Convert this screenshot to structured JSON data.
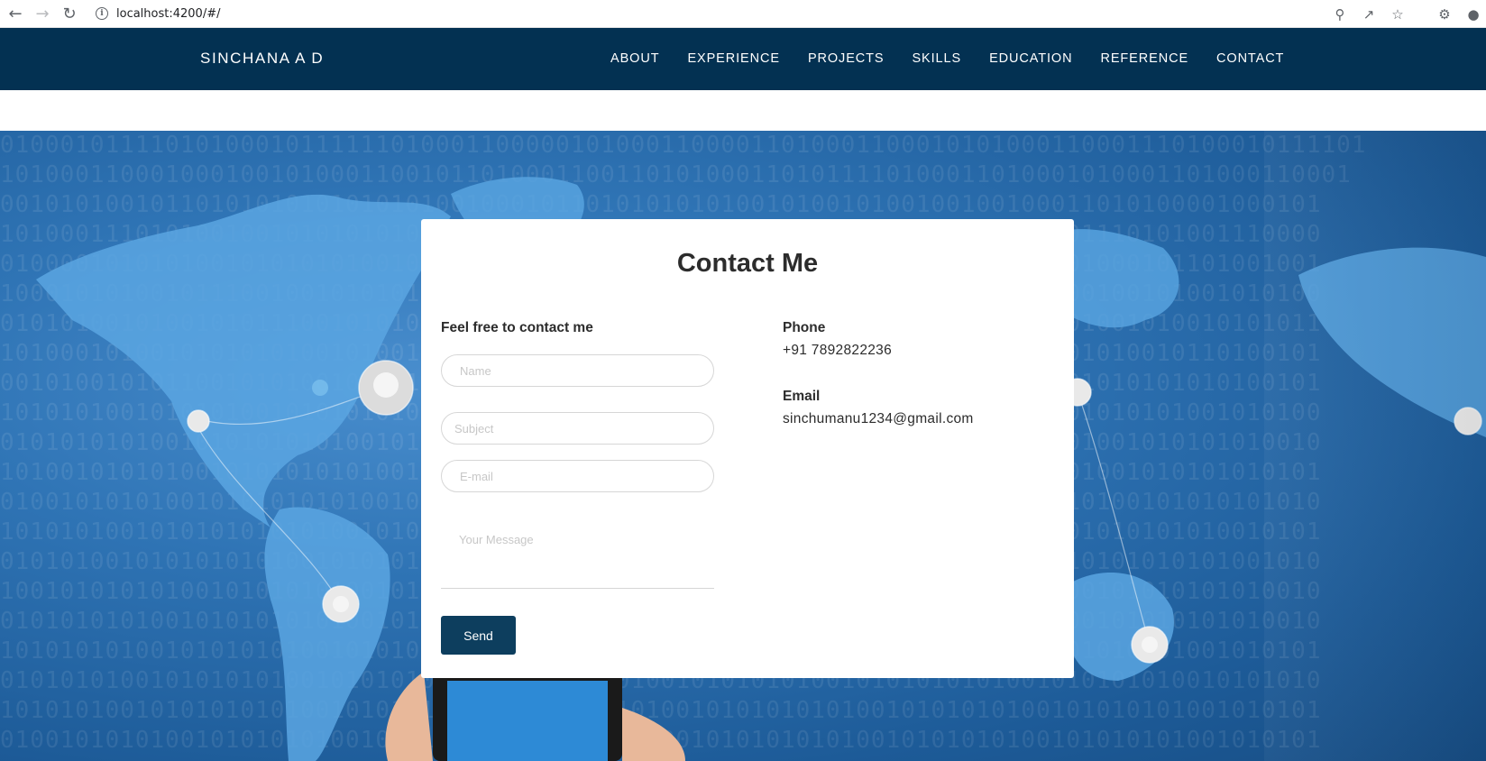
{
  "browser": {
    "url": "localhost:4200/#/"
  },
  "site": {
    "brand": "SINCHANA A D",
    "menu": [
      "ABOUT",
      "EXPERIENCE",
      "PROJECTS",
      "SKILLS",
      "EDUCATION",
      "REFERENCE",
      "CONTACT"
    ]
  },
  "contact": {
    "title": "Contact Me",
    "form_heading": "Feel free to contact me",
    "name_placeholder": "Name",
    "subject_placeholder": "Subject",
    "email_placeholder": "E-mail",
    "message_placeholder": "Your Message",
    "send_label": "Send",
    "phone_label": "Phone",
    "phone_value": "+91 7892822236",
    "email_label": "Email",
    "email_value": "sinchumanu1234@gmail.com"
  },
  "colors": {
    "header_bg": "#033152",
    "send_button": "#0d3e5e",
    "hero_bg": "#1f5f9a"
  }
}
